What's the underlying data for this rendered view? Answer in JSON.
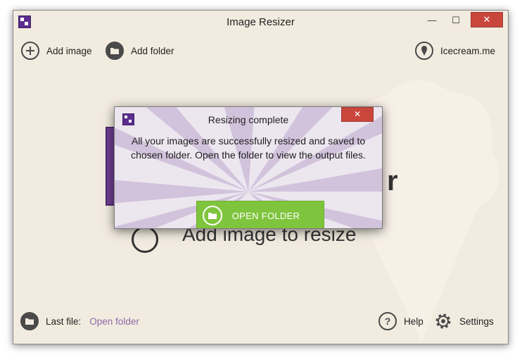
{
  "window": {
    "title": "Image Resizer",
    "close_glyph": "✕",
    "minimize_glyph": "—",
    "maximize_glyph": "☐"
  },
  "toolbar": {
    "add_image_label": "Add image",
    "add_folder_label": "Add folder",
    "icecream_label": "Icecream.me"
  },
  "main": {
    "big_letter": "r",
    "add_image_prompt": "Add image to resize"
  },
  "footer": {
    "last_file_label": "Last file:",
    "open_folder_link": "Open folder",
    "help_label": "Help",
    "settings_label": "Settings"
  },
  "dialog": {
    "title": "Resizing complete",
    "close_glyph": "✕",
    "message": "All your images are successfully resized and saved to chosen folder. Open the folder to view the output files.",
    "button_label": "OPEN FOLDER"
  },
  "colors": {
    "window_bg": "#f2ebdf",
    "brand_purple": "#5b2d8e",
    "accent_green": "#7fc43d",
    "close_red": "#c9463d",
    "link_purple": "#8a6aa8"
  },
  "icons": [
    "app-logo-icon",
    "plus-icon",
    "folder-icon",
    "icecream-icon",
    "question-icon",
    "gear-icon"
  ]
}
